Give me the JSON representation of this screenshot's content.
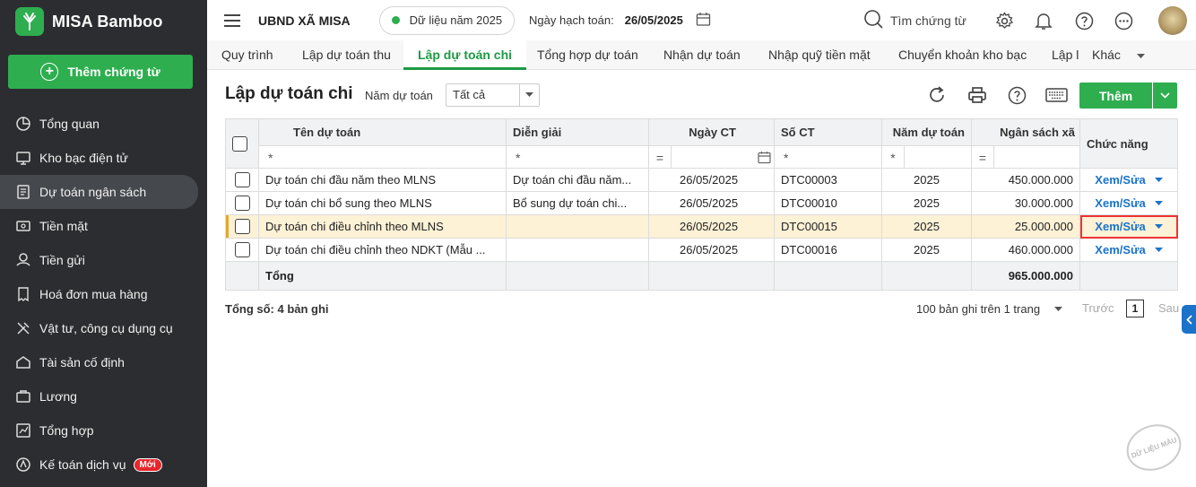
{
  "brand": {
    "name": "MISA Bamboo",
    "logo_icon": "bamboo-logo-icon",
    "color": "#2eae4f"
  },
  "sidebar": {
    "add_button": "Thêm chứng từ",
    "items": [
      {
        "label": "Tổng quan",
        "icon": "pie-chart-icon"
      },
      {
        "label": "Kho bạc điện tử",
        "icon": "monitor-icon"
      },
      {
        "label": "Dự toán ngân sách",
        "icon": "budget-icon",
        "active": true
      },
      {
        "label": "Tiền mặt",
        "icon": "cash-icon"
      },
      {
        "label": "Tiền gửi",
        "icon": "bank-deposit-icon"
      },
      {
        "label": "Hoá đơn mua hàng",
        "icon": "invoice-icon"
      },
      {
        "label": "Vật tư, công cụ dụng cụ",
        "icon": "tools-icon"
      },
      {
        "label": "Tài sản cố định",
        "icon": "asset-icon"
      },
      {
        "label": "Lương",
        "icon": "salary-icon"
      },
      {
        "label": "Tổng hợp",
        "icon": "summary-icon"
      },
      {
        "label": "Kế toán dịch vụ",
        "icon": "service-icon",
        "badge": "Mới"
      }
    ]
  },
  "header": {
    "org": "UBND XÃ MISA",
    "data_year": "Dữ liệu năm 2025",
    "accounting_date_label": "Ngày hạch toán:",
    "accounting_date": "26/05/2025",
    "search_placeholder": "Tìm chứng từ"
  },
  "tabs": [
    "Quy trình",
    "Lập dự toán thu",
    "Lập dự toán chi",
    "Tổng hợp dự toán",
    "Nhận dự toán",
    "Nhập quỹ tiền mặt",
    "Chuyển khoản kho bạc",
    "Lập l"
  ],
  "active_tab": 2,
  "tab_more": "Khác",
  "page": {
    "title": "Lập dự toán chi",
    "filter_label": "Năm dự toán",
    "filter_value": "Tất cả",
    "add_button": "Thêm"
  },
  "table": {
    "columns": [
      "Tên dự toán",
      "Diễn giải",
      "Ngày CT",
      "Số CT",
      "Năm dự toán",
      "Ngân sách xã",
      "Chức năng"
    ],
    "filter_ops": {
      "name": "*",
      "desc": "*",
      "date": "=",
      "number": "*",
      "year": "*",
      "amount": "="
    },
    "rows": [
      {
        "name": "Dự toán chi đầu năm theo MLNS",
        "desc": "Dự toán chi đầu năm...",
        "date": "26/05/2025",
        "number": "DTC00003",
        "year": "2025",
        "amount": "450.000.000",
        "action": "Xem/Sửa"
      },
      {
        "name": "Dự toán chi bổ sung theo MLNS",
        "desc": "Bổ sung dự toán chi...",
        "date": "26/05/2025",
        "number": "DTC00010",
        "year": "2025",
        "amount": "30.000.000",
        "action": "Xem/Sửa"
      },
      {
        "name": "Dự toán chi điều chỉnh theo MLNS",
        "desc": "",
        "date": "26/05/2025",
        "number": "DTC00015",
        "year": "2025",
        "amount": "25.000.000",
        "action": "Xem/Sửa",
        "selected": true
      },
      {
        "name": "Dự toán chi điều chỉnh theo NDKT (Mẫu ...",
        "desc": "",
        "date": "26/05/2025",
        "number": "DTC00016",
        "year": "2025",
        "amount": "460.000.000",
        "action": "Xem/Sửa"
      }
    ],
    "total_label": "Tổng",
    "total_amount": "965.000.000"
  },
  "footer": {
    "total_count": "Tổng số: 4 bản ghi",
    "page_size": "100 bản ghi trên 1 trang",
    "prev": "Trước",
    "page": "1",
    "next": "Sau"
  },
  "watermark": "DỮ LIỆU MẪU"
}
